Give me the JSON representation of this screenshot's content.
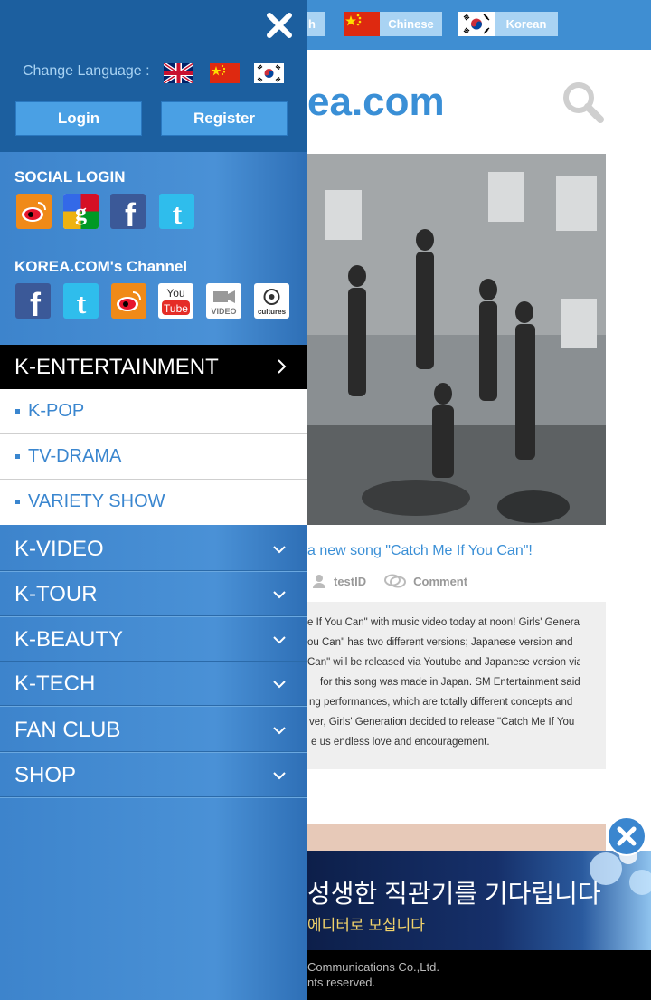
{
  "page": {
    "languages": [
      {
        "label": "Chinese",
        "flag": "china-flag-icon"
      },
      {
        "label": "Korean",
        "flag": "korea-flag-icon"
      }
    ],
    "english_partial": "h",
    "logo_partial": "ea.com",
    "article": {
      "title_partial": "a new song \"Catch Me If You Can\"!",
      "author": "testID",
      "comment_label": "Comment",
      "body_lines": [
        "e If You Can\" with music video today at noon! Girls' Genera-",
        "ou Can\" has two different versions; Japanese version and",
        "Can\" will be released via Youtube and Japanese version via",
        "for this song was made in Japan. SM Entertainment said",
        "ng performances, which are totally different concepts and",
        "ver, Girls' Generation decided to release \"Catch Me If You",
        "e us endless love and encouragement."
      ]
    },
    "ad": {
      "line1": "성생한 직관기를 기다립니다",
      "line2": "에디터로 모십니다"
    },
    "footer": {
      "line1": "Communications Co.,Ltd.",
      "line2": "nts reserved."
    }
  },
  "drawer": {
    "change_language_label": "Change Language :",
    "flags": [
      "uk-flag-icon",
      "china-flag-icon",
      "korea-flag-icon"
    ],
    "login_label": "Login",
    "register_label": "Register",
    "social_login_label": "SOCIAL LOGIN",
    "social_login_icons": [
      "weibo-icon",
      "google-icon",
      "facebook-icon",
      "twitter-icon"
    ],
    "channel_label": "KOREA.COM's Channel",
    "channel_icons": [
      "facebook-icon",
      "twitter-icon",
      "weibo-icon",
      "youtube-icon",
      "video-icon",
      "kcultures-icon"
    ],
    "video_icon_text": "VIDEO",
    "kcultures_icon_text": "cultures",
    "active_menu": "K-ENTERTAINMENT",
    "submenu": [
      "K-POP",
      "TV-DRAMA",
      "VARIETY SHOW"
    ],
    "menu": [
      "K-VIDEO",
      "K-TOUR",
      "K-BEAUTY",
      "K-TECH",
      "FAN CLUB",
      "SHOP"
    ]
  },
  "colors": {
    "accent": "#3a86cf",
    "drawer_dark": "#1c5f9f",
    "topbar": "#3f8ed2"
  }
}
